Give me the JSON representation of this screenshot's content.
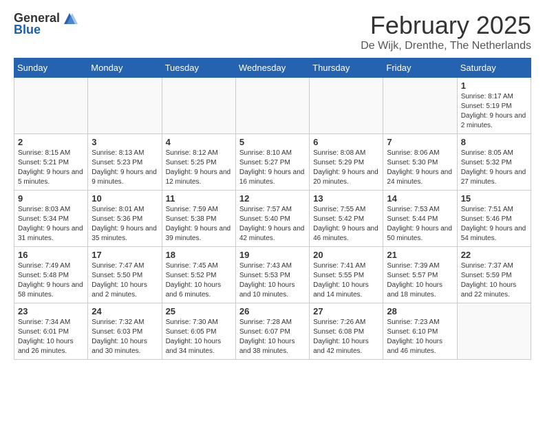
{
  "header": {
    "logo_general": "General",
    "logo_blue": "Blue",
    "title": "February 2025",
    "location": "De Wijk, Drenthe, The Netherlands"
  },
  "weekdays": [
    "Sunday",
    "Monday",
    "Tuesday",
    "Wednesday",
    "Thursday",
    "Friday",
    "Saturday"
  ],
  "weeks": [
    [
      {
        "day": "",
        "info": ""
      },
      {
        "day": "",
        "info": ""
      },
      {
        "day": "",
        "info": ""
      },
      {
        "day": "",
        "info": ""
      },
      {
        "day": "",
        "info": ""
      },
      {
        "day": "",
        "info": ""
      },
      {
        "day": "1",
        "info": "Sunrise: 8:17 AM\nSunset: 5:19 PM\nDaylight: 9 hours and 2 minutes."
      }
    ],
    [
      {
        "day": "2",
        "info": "Sunrise: 8:15 AM\nSunset: 5:21 PM\nDaylight: 9 hours and 5 minutes."
      },
      {
        "day": "3",
        "info": "Sunrise: 8:13 AM\nSunset: 5:23 PM\nDaylight: 9 hours and 9 minutes."
      },
      {
        "day": "4",
        "info": "Sunrise: 8:12 AM\nSunset: 5:25 PM\nDaylight: 9 hours and 12 minutes."
      },
      {
        "day": "5",
        "info": "Sunrise: 8:10 AM\nSunset: 5:27 PM\nDaylight: 9 hours and 16 minutes."
      },
      {
        "day": "6",
        "info": "Sunrise: 8:08 AM\nSunset: 5:29 PM\nDaylight: 9 hours and 20 minutes."
      },
      {
        "day": "7",
        "info": "Sunrise: 8:06 AM\nSunset: 5:30 PM\nDaylight: 9 hours and 24 minutes."
      },
      {
        "day": "8",
        "info": "Sunrise: 8:05 AM\nSunset: 5:32 PM\nDaylight: 9 hours and 27 minutes."
      }
    ],
    [
      {
        "day": "9",
        "info": "Sunrise: 8:03 AM\nSunset: 5:34 PM\nDaylight: 9 hours and 31 minutes."
      },
      {
        "day": "10",
        "info": "Sunrise: 8:01 AM\nSunset: 5:36 PM\nDaylight: 9 hours and 35 minutes."
      },
      {
        "day": "11",
        "info": "Sunrise: 7:59 AM\nSunset: 5:38 PM\nDaylight: 9 hours and 39 minutes."
      },
      {
        "day": "12",
        "info": "Sunrise: 7:57 AM\nSunset: 5:40 PM\nDaylight: 9 hours and 42 minutes."
      },
      {
        "day": "13",
        "info": "Sunrise: 7:55 AM\nSunset: 5:42 PM\nDaylight: 9 hours and 46 minutes."
      },
      {
        "day": "14",
        "info": "Sunrise: 7:53 AM\nSunset: 5:44 PM\nDaylight: 9 hours and 50 minutes."
      },
      {
        "day": "15",
        "info": "Sunrise: 7:51 AM\nSunset: 5:46 PM\nDaylight: 9 hours and 54 minutes."
      }
    ],
    [
      {
        "day": "16",
        "info": "Sunrise: 7:49 AM\nSunset: 5:48 PM\nDaylight: 9 hours and 58 minutes."
      },
      {
        "day": "17",
        "info": "Sunrise: 7:47 AM\nSunset: 5:50 PM\nDaylight: 10 hours and 2 minutes."
      },
      {
        "day": "18",
        "info": "Sunrise: 7:45 AM\nSunset: 5:52 PM\nDaylight: 10 hours and 6 minutes."
      },
      {
        "day": "19",
        "info": "Sunrise: 7:43 AM\nSunset: 5:53 PM\nDaylight: 10 hours and 10 minutes."
      },
      {
        "day": "20",
        "info": "Sunrise: 7:41 AM\nSunset: 5:55 PM\nDaylight: 10 hours and 14 minutes."
      },
      {
        "day": "21",
        "info": "Sunrise: 7:39 AM\nSunset: 5:57 PM\nDaylight: 10 hours and 18 minutes."
      },
      {
        "day": "22",
        "info": "Sunrise: 7:37 AM\nSunset: 5:59 PM\nDaylight: 10 hours and 22 minutes."
      }
    ],
    [
      {
        "day": "23",
        "info": "Sunrise: 7:34 AM\nSunset: 6:01 PM\nDaylight: 10 hours and 26 minutes."
      },
      {
        "day": "24",
        "info": "Sunrise: 7:32 AM\nSunset: 6:03 PM\nDaylight: 10 hours and 30 minutes."
      },
      {
        "day": "25",
        "info": "Sunrise: 7:30 AM\nSunset: 6:05 PM\nDaylight: 10 hours and 34 minutes."
      },
      {
        "day": "26",
        "info": "Sunrise: 7:28 AM\nSunset: 6:07 PM\nDaylight: 10 hours and 38 minutes."
      },
      {
        "day": "27",
        "info": "Sunrise: 7:26 AM\nSunset: 6:08 PM\nDaylight: 10 hours and 42 minutes."
      },
      {
        "day": "28",
        "info": "Sunrise: 7:23 AM\nSunset: 6:10 PM\nDaylight: 10 hours and 46 minutes."
      },
      {
        "day": "",
        "info": ""
      }
    ]
  ]
}
